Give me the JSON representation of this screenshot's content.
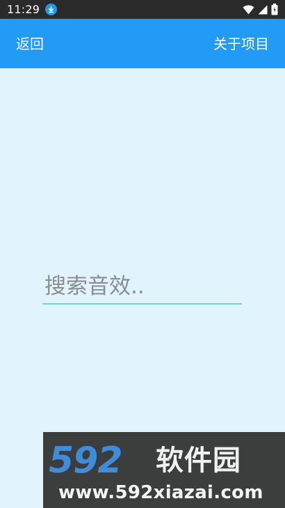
{
  "status_bar": {
    "time": "11:29",
    "icons": [
      "download-icon",
      "wifi-icon",
      "signal-icon",
      "battery-icon"
    ]
  },
  "app_bar": {
    "back_label": "返回",
    "about_label": "关于项目",
    "background": "#219bf6"
  },
  "search": {
    "placeholder": "搜索音效..",
    "value": ""
  },
  "watermark": {
    "brand_number": "592",
    "brand_text": "软件园",
    "url": "www.592xiazai.com"
  },
  "colors": {
    "page_background": "#e1f3fd",
    "status_bar": "#2a2a2a",
    "accent": "#219bf6",
    "underline": "#71d2ea"
  }
}
